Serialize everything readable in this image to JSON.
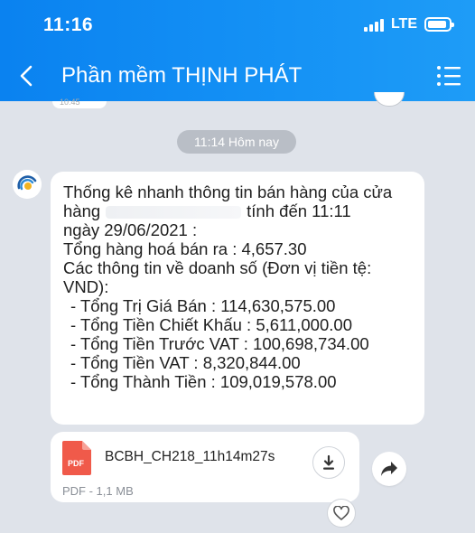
{
  "status_bar": {
    "time": "11:16",
    "network": "LTE"
  },
  "header": {
    "title": "Phần mềm THỊNH PHÁT"
  },
  "previous_message": {
    "time_fragment": "10:45"
  },
  "time_divider": "11:14 Hôm nay",
  "message": {
    "lines": {
      "l1": "Thống kê nhanh thông tin bán hàng của cửa",
      "l2a": "hàng",
      "l2b": "tính đến 11:11",
      "l3": "ngày 29/06/2021 :",
      "l4": "Tổng hàng hoá bán ra : 4,657.30",
      "l5": "Các thông tin về doanh số (Đơn vị tiền tệ:",
      "l6": "VND):",
      "l7": "- Tổng Trị Giá Bán : 114,630,575.00",
      "l8": "- Tổng Tiền Chiết Khấu : 5,611,000.00",
      "l9": "- Tổng Tiền Trước VAT : 100,698,734.00",
      "l10": "- Tổng Tiền VAT : 8,320,844.00",
      "l11": "- Tổng Thành Tiền : 109,019,578.00"
    }
  },
  "file": {
    "icon_label": "PDF",
    "name": "BCBH_CH218_11h14m27s",
    "meta": "PDF - 1,1 MB"
  },
  "icons": [
    "back-icon",
    "menu-icon",
    "download-icon",
    "share-icon",
    "heart-icon",
    "pdf-icon",
    "avatar-logo"
  ],
  "colors": {
    "header": "#0a82f0",
    "pdf_red": "#f05a4a",
    "chat_background": "#dfe3ea"
  }
}
